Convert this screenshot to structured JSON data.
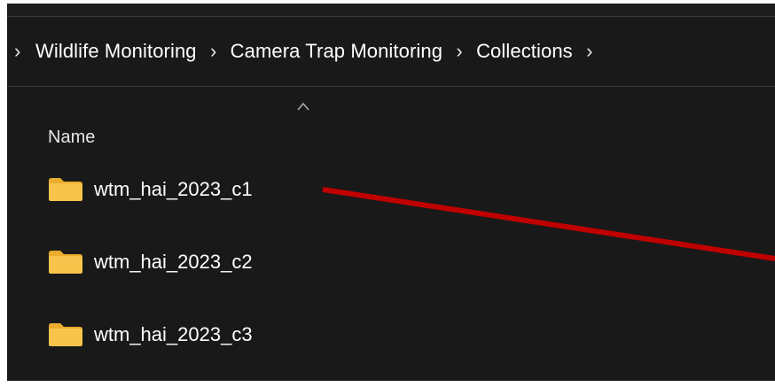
{
  "breadcrumb": {
    "items": [
      {
        "label": "Wildlife Monitoring"
      },
      {
        "label": "Camera Trap Monitoring"
      },
      {
        "label": "Collections"
      }
    ],
    "separator": "›"
  },
  "columns": {
    "name_label": "Name"
  },
  "folders": [
    {
      "name": "wtm_hai_2023_c1"
    },
    {
      "name": "wtm_hai_2023_c2"
    },
    {
      "name": "wtm_hai_2023_c3"
    }
  ],
  "colors": {
    "background": "#191919",
    "folder": "#f8c44c",
    "annotation": "#c00000",
    "divider": "#3b3b3b"
  },
  "icons": {
    "folder": "folder-icon",
    "sort": "sort-ascending-icon",
    "separator": "chevron-right-icon"
  }
}
